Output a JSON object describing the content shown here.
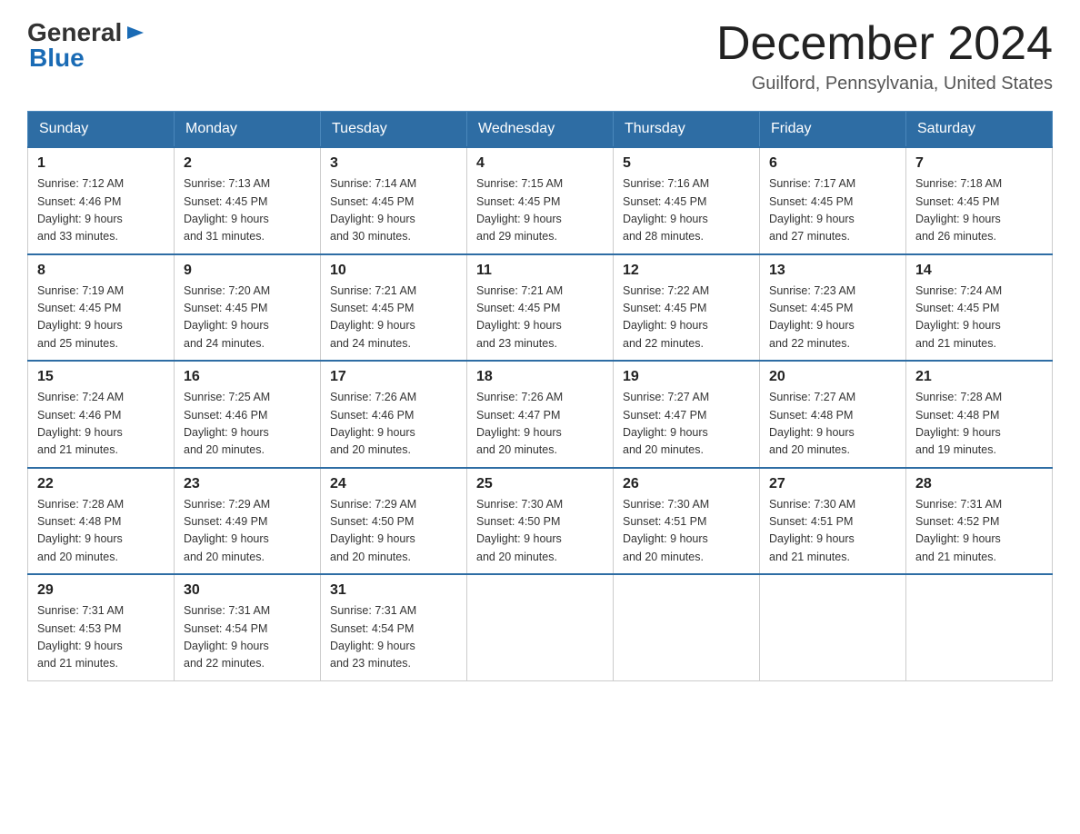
{
  "header": {
    "logo_general": "General",
    "logo_blue": "Blue",
    "title": "December 2024",
    "location": "Guilford, Pennsylvania, United States"
  },
  "weekdays": [
    "Sunday",
    "Monday",
    "Tuesday",
    "Wednesday",
    "Thursday",
    "Friday",
    "Saturday"
  ],
  "weeks": [
    [
      {
        "day": "1",
        "sunrise": "7:12 AM",
        "sunset": "4:46 PM",
        "daylight": "9 hours and 33 minutes."
      },
      {
        "day": "2",
        "sunrise": "7:13 AM",
        "sunset": "4:45 PM",
        "daylight": "9 hours and 31 minutes."
      },
      {
        "day": "3",
        "sunrise": "7:14 AM",
        "sunset": "4:45 PM",
        "daylight": "9 hours and 30 minutes."
      },
      {
        "day": "4",
        "sunrise": "7:15 AM",
        "sunset": "4:45 PM",
        "daylight": "9 hours and 29 minutes."
      },
      {
        "day": "5",
        "sunrise": "7:16 AM",
        "sunset": "4:45 PM",
        "daylight": "9 hours and 28 minutes."
      },
      {
        "day": "6",
        "sunrise": "7:17 AM",
        "sunset": "4:45 PM",
        "daylight": "9 hours and 27 minutes."
      },
      {
        "day": "7",
        "sunrise": "7:18 AM",
        "sunset": "4:45 PM",
        "daylight": "9 hours and 26 minutes."
      }
    ],
    [
      {
        "day": "8",
        "sunrise": "7:19 AM",
        "sunset": "4:45 PM",
        "daylight": "9 hours and 25 minutes."
      },
      {
        "day": "9",
        "sunrise": "7:20 AM",
        "sunset": "4:45 PM",
        "daylight": "9 hours and 24 minutes."
      },
      {
        "day": "10",
        "sunrise": "7:21 AM",
        "sunset": "4:45 PM",
        "daylight": "9 hours and 24 minutes."
      },
      {
        "day": "11",
        "sunrise": "7:21 AM",
        "sunset": "4:45 PM",
        "daylight": "9 hours and 23 minutes."
      },
      {
        "day": "12",
        "sunrise": "7:22 AM",
        "sunset": "4:45 PM",
        "daylight": "9 hours and 22 minutes."
      },
      {
        "day": "13",
        "sunrise": "7:23 AM",
        "sunset": "4:45 PM",
        "daylight": "9 hours and 22 minutes."
      },
      {
        "day": "14",
        "sunrise": "7:24 AM",
        "sunset": "4:45 PM",
        "daylight": "9 hours and 21 minutes."
      }
    ],
    [
      {
        "day": "15",
        "sunrise": "7:24 AM",
        "sunset": "4:46 PM",
        "daylight": "9 hours and 21 minutes."
      },
      {
        "day": "16",
        "sunrise": "7:25 AM",
        "sunset": "4:46 PM",
        "daylight": "9 hours and 20 minutes."
      },
      {
        "day": "17",
        "sunrise": "7:26 AM",
        "sunset": "4:46 PM",
        "daylight": "9 hours and 20 minutes."
      },
      {
        "day": "18",
        "sunrise": "7:26 AM",
        "sunset": "4:47 PM",
        "daylight": "9 hours and 20 minutes."
      },
      {
        "day": "19",
        "sunrise": "7:27 AM",
        "sunset": "4:47 PM",
        "daylight": "9 hours and 20 minutes."
      },
      {
        "day": "20",
        "sunrise": "7:27 AM",
        "sunset": "4:48 PM",
        "daylight": "9 hours and 20 minutes."
      },
      {
        "day": "21",
        "sunrise": "7:28 AM",
        "sunset": "4:48 PM",
        "daylight": "9 hours and 19 minutes."
      }
    ],
    [
      {
        "day": "22",
        "sunrise": "7:28 AM",
        "sunset": "4:48 PM",
        "daylight": "9 hours and 20 minutes."
      },
      {
        "day": "23",
        "sunrise": "7:29 AM",
        "sunset": "4:49 PM",
        "daylight": "9 hours and 20 minutes."
      },
      {
        "day": "24",
        "sunrise": "7:29 AM",
        "sunset": "4:50 PM",
        "daylight": "9 hours and 20 minutes."
      },
      {
        "day": "25",
        "sunrise": "7:30 AM",
        "sunset": "4:50 PM",
        "daylight": "9 hours and 20 minutes."
      },
      {
        "day": "26",
        "sunrise": "7:30 AM",
        "sunset": "4:51 PM",
        "daylight": "9 hours and 20 minutes."
      },
      {
        "day": "27",
        "sunrise": "7:30 AM",
        "sunset": "4:51 PM",
        "daylight": "9 hours and 21 minutes."
      },
      {
        "day": "28",
        "sunrise": "7:31 AM",
        "sunset": "4:52 PM",
        "daylight": "9 hours and 21 minutes."
      }
    ],
    [
      {
        "day": "29",
        "sunrise": "7:31 AM",
        "sunset": "4:53 PM",
        "daylight": "9 hours and 21 minutes."
      },
      {
        "day": "30",
        "sunrise": "7:31 AM",
        "sunset": "4:54 PM",
        "daylight": "9 hours and 22 minutes."
      },
      {
        "day": "31",
        "sunrise": "7:31 AM",
        "sunset": "4:54 PM",
        "daylight": "9 hours and 23 minutes."
      },
      null,
      null,
      null,
      null
    ]
  ]
}
